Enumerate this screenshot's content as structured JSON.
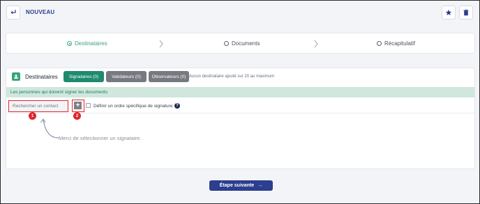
{
  "header": {
    "title": "NOUVEAU"
  },
  "steps": [
    {
      "label": "Destinataires",
      "active": true
    },
    {
      "label": "Documents",
      "active": false
    },
    {
      "label": "Récapitulatif",
      "active": false
    }
  ],
  "panel": {
    "section_label": "Destinataires",
    "tabs": {
      "signataires": "Signataires (0)",
      "validateurs": "Validateurs (0)",
      "observateurs": "Observateurs (0)"
    },
    "limit_text": "Aucun destinataire ajouté sur 20 au maximum",
    "info_text": "Les personnes qui doivent signer les documents",
    "search_placeholder": "Rechercher un contact",
    "add_symbol": "+",
    "order_label": "Définir un ordre spécifique de signature",
    "help_symbol": "?",
    "badge_1": "1",
    "badge_2": "2",
    "hint_text": "Merci de sélectionner un signataire."
  },
  "footer": {
    "next_label": "Étape suivante",
    "next_arrow": "→"
  },
  "colors": {
    "accent_green": "#3aa37b",
    "primary_blue": "#2c3e8f",
    "highlight_red": "#e0252b"
  }
}
